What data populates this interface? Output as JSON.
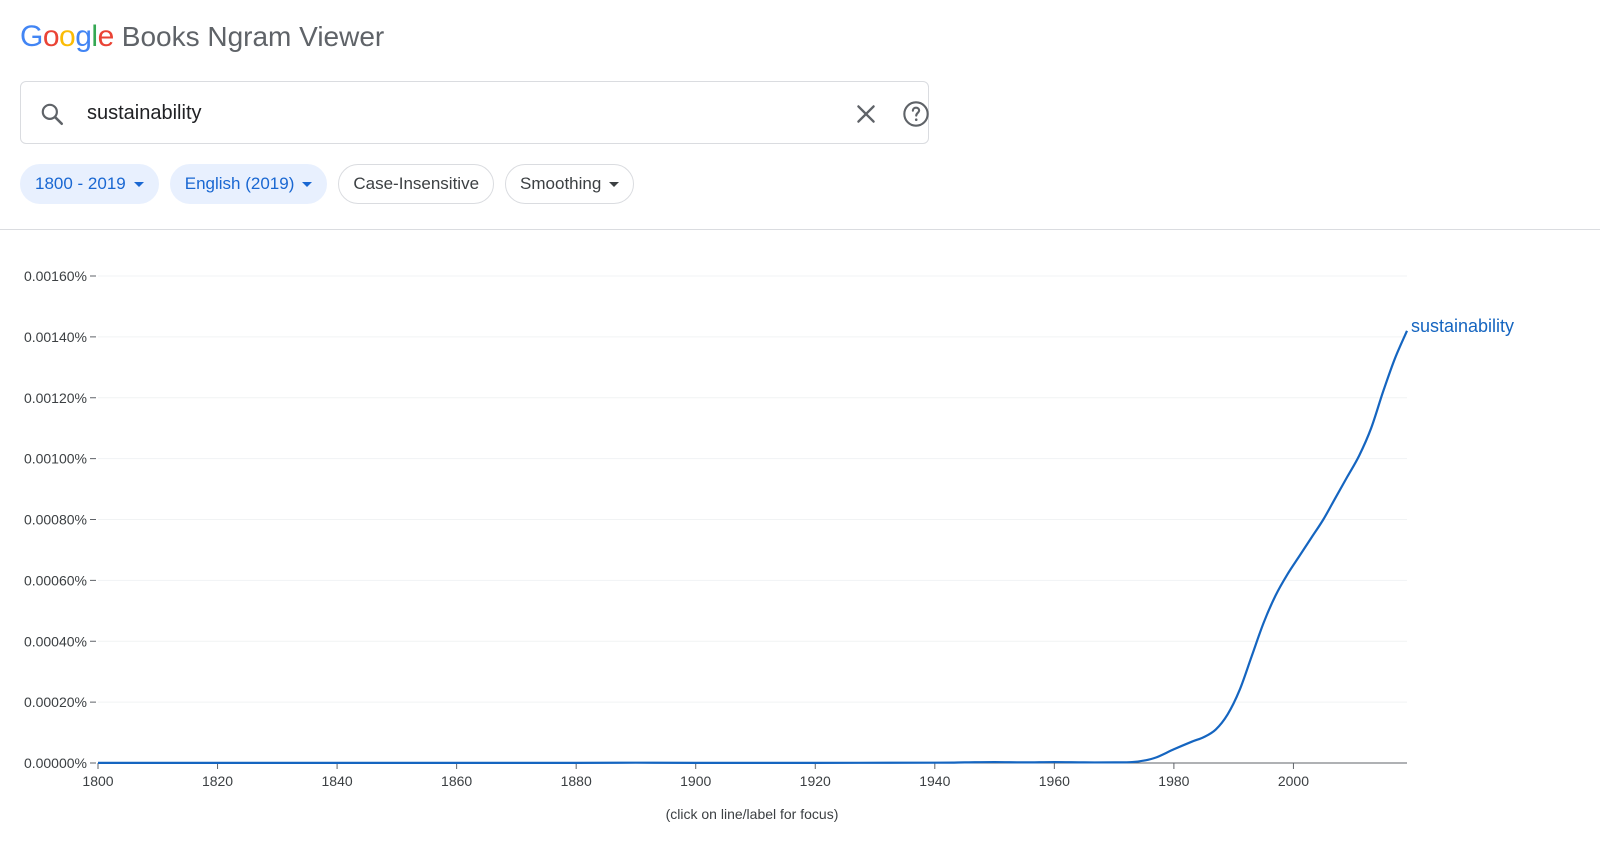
{
  "header": {
    "logo_letters": [
      {
        "ch": "G",
        "color": "#4285F4"
      },
      {
        "ch": "o",
        "color": "#EA4335"
      },
      {
        "ch": "o",
        "color": "#FBBC05"
      },
      {
        "ch": "g",
        "color": "#4285F4"
      },
      {
        "ch": "l",
        "color": "#34A853"
      },
      {
        "ch": "e",
        "color": "#EA4335"
      }
    ],
    "product_name": "Books Ngram Viewer"
  },
  "search": {
    "value": "sustainability",
    "search_icon": "search-icon",
    "clear_icon": "close-icon",
    "help_icon": "help-icon"
  },
  "filters": [
    {
      "label": "1800 - 2019",
      "active": true,
      "dropdown": true
    },
    {
      "label": "English (2019)",
      "active": true,
      "dropdown": true
    },
    {
      "label": "Case-Insensitive",
      "active": false,
      "dropdown": false
    },
    {
      "label": "Smoothing",
      "active": false,
      "dropdown": true
    }
  ],
  "colors": {
    "series": "#1565c0",
    "accent": "#1967d2"
  },
  "chart_data": {
    "type": "line",
    "xlim": [
      1800,
      2019
    ],
    "ylim": [
      0,
      0.0016
    ],
    "x_ticks": [
      1800,
      1820,
      1840,
      1860,
      1880,
      1900,
      1920,
      1940,
      1960,
      1980,
      2000
    ],
    "y_ticks": [
      "0.00000%",
      "0.00020%",
      "0.00040%",
      "0.00060%",
      "0.00080%",
      "0.00100%",
      "0.00120%",
      "0.00140%",
      "0.00160%"
    ],
    "y_tick_values": [
      0,
      0.0002,
      0.0004,
      0.0006,
      0.0008,
      0.001,
      0.0012,
      0.0014,
      0.0016
    ],
    "series": [
      {
        "name": "sustainability",
        "x": [
          1800,
          1820,
          1840,
          1860,
          1880,
          1890,
          1900,
          1920,
          1940,
          1945,
          1950,
          1955,
          1960,
          1965,
          1970,
          1973,
          1975,
          1977,
          1980,
          1983,
          1985,
          1987,
          1989,
          1991,
          1993,
          1995,
          1997,
          1999,
          2001,
          2003,
          2005,
          2007,
          2009,
          2011,
          2013,
          2015,
          2017,
          2019
        ],
        "y": [
          5e-07,
          5e-07,
          5e-07,
          5e-07,
          5e-07,
          1e-06,
          5e-07,
          5e-07,
          1e-06,
          2e-06,
          3e-06,
          2e-06,
          3e-06,
          2e-06,
          2e-06,
          3e-06,
          8e-06,
          1.8e-05,
          4.5e-05,
          7e-05,
          8.5e-05,
          0.00011,
          0.00016,
          0.00024,
          0.00035,
          0.00046,
          0.00055,
          0.00062,
          0.00068,
          0.00074,
          0.0008,
          0.00087,
          0.00094,
          0.00101,
          0.0011,
          0.00122,
          0.00133,
          0.00142
        ]
      }
    ],
    "grid": true,
    "footnote": "(click on line/label for focus)"
  }
}
